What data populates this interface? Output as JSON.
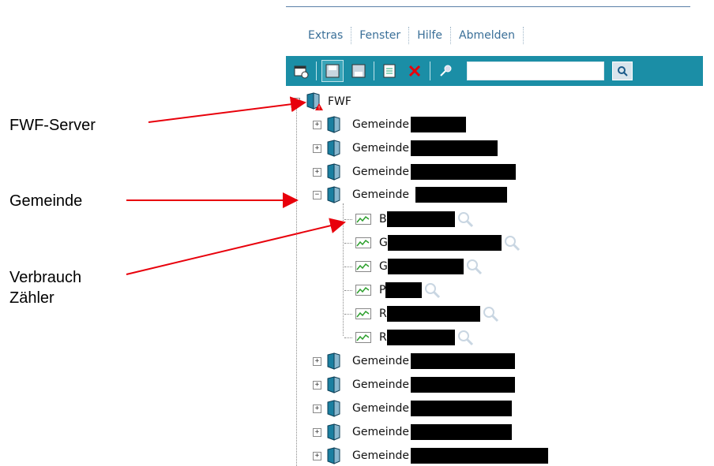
{
  "menu": [
    "Extras",
    "Fenster",
    "Hilfe",
    "Abmelden"
  ],
  "toolbar": {
    "icons": [
      "new-window-icon",
      "save-icon",
      "save-as-icon",
      "list-icon",
      "delete-icon",
      "pin-icon"
    ],
    "search_value": ""
  },
  "tree": {
    "root_label": "FWF",
    "gemeinde_label": "Gemeinde",
    "meters": [
      "B",
      "G",
      "G",
      "P",
      "R",
      "R"
    ]
  },
  "annotations": {
    "server": "FWF-Server",
    "gemeinde": "Gemeinde",
    "zaehler_line1": "Verbrauch",
    "zaehler_line2": "Zähler"
  },
  "colors": {
    "toolbar": "#1b8ea6",
    "menu_text": "#3a6f98",
    "arrow": "#e8000b"
  }
}
